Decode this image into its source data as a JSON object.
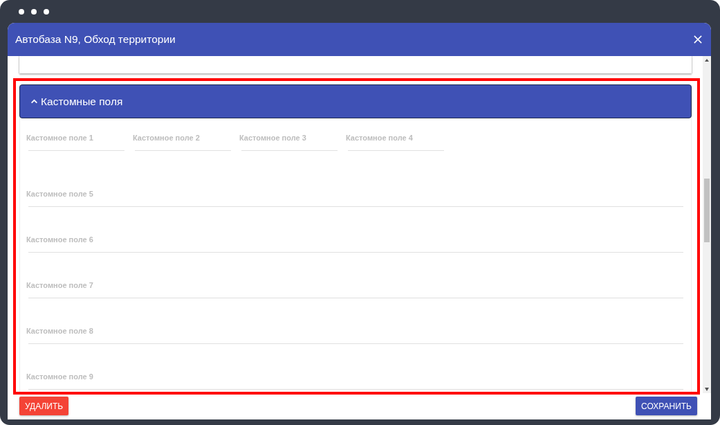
{
  "window": {
    "title": "Автобаза N9, Обход территории"
  },
  "panel": {
    "title": "Кастомные поля",
    "expanded": true,
    "fields": [
      {
        "label": "Кастомное поле 1",
        "kind": "inline"
      },
      {
        "label": "Кастомное поле 2",
        "kind": "inline"
      },
      {
        "label": "Кастомное поле 3",
        "kind": "inline"
      },
      {
        "label": "Кастомное поле 4",
        "kind": "inline"
      },
      {
        "label": "Кастомное поле 5",
        "kind": "wide"
      },
      {
        "label": "Кастомное поле 6",
        "kind": "wide"
      },
      {
        "label": "Кастомное поле 7",
        "kind": "wide"
      },
      {
        "label": "Кастомное поле 8",
        "kind": "wide"
      },
      {
        "label": "Кастомное поле 9",
        "kind": "wide"
      }
    ]
  },
  "buttons": [
    {
      "label": "УДАЛИТЬ",
      "kind": "danger"
    },
    {
      "label": "СОХРАНИТЬ",
      "kind": "primary"
    }
  ]
}
